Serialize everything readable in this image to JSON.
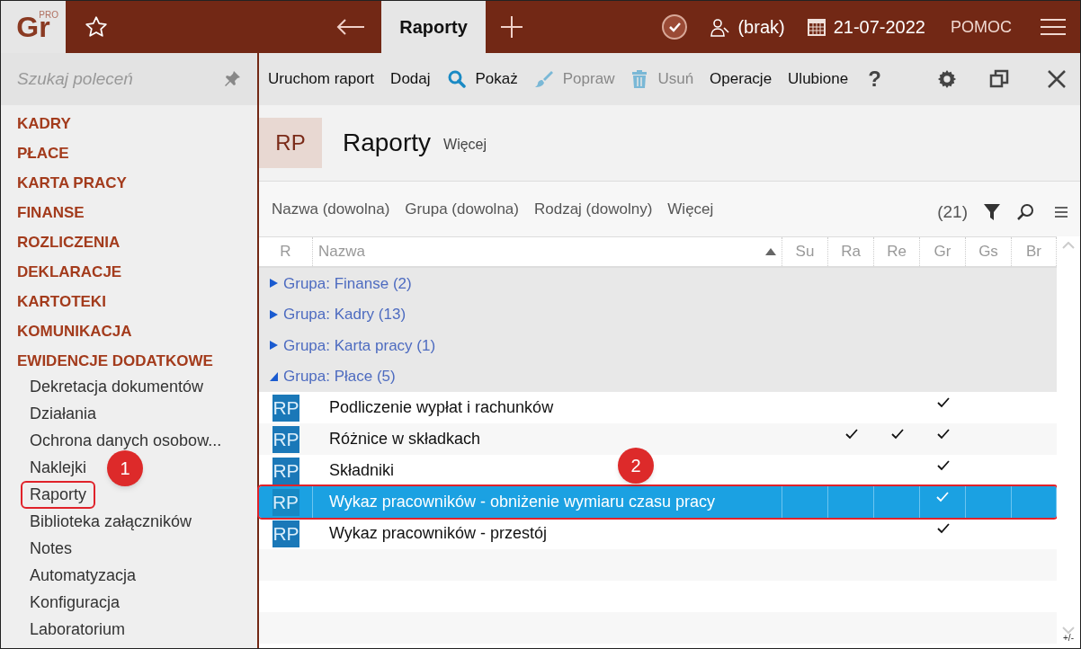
{
  "app": {
    "logo": "Gr",
    "logo_badge": "PRO"
  },
  "topbar": {
    "active_tab": "Raporty",
    "user": "(brak)",
    "date": "21-07-2022",
    "help": "POMOC"
  },
  "search": {
    "placeholder": "Szukaj poleceń"
  },
  "sidebar": {
    "items": [
      {
        "kind": "section",
        "label": "KADRY",
        "outlined": false
      },
      {
        "kind": "section",
        "label": "PŁACE",
        "outlined": false
      },
      {
        "kind": "section",
        "label": "KARTA PRACY",
        "outlined": false
      },
      {
        "kind": "section",
        "label": "FINANSE",
        "outlined": false
      },
      {
        "kind": "section",
        "label": "ROZLICZENIA",
        "outlined": false
      },
      {
        "kind": "section",
        "label": "DEKLARACJE",
        "outlined": false
      },
      {
        "kind": "section",
        "label": "KARTOTEKI",
        "outlined": false
      },
      {
        "kind": "section",
        "label": "KOMUNIKACJA",
        "outlined": false
      },
      {
        "kind": "section",
        "label": "EWIDENCJE DODATKOWE",
        "outlined": false
      },
      {
        "kind": "item",
        "label": "Dekretacja dokumentów",
        "outlined": false
      },
      {
        "kind": "item",
        "label": "Działania",
        "outlined": false
      },
      {
        "kind": "item",
        "label": "Ochrona danych osobow...",
        "outlined": false
      },
      {
        "kind": "item",
        "label": "Naklejki",
        "outlined": false
      },
      {
        "kind": "item",
        "label": "Raporty",
        "outlined": true
      },
      {
        "kind": "item",
        "label": "Biblioteka załączników",
        "outlined": false
      },
      {
        "kind": "item",
        "label": "Notes",
        "outlined": false
      },
      {
        "kind": "item",
        "label": "Automatyzacja",
        "outlined": false
      },
      {
        "kind": "item",
        "label": "Konfiguracja",
        "outlined": false
      },
      {
        "kind": "item",
        "label": "Laboratorium",
        "outlined": false
      }
    ]
  },
  "toolbar": [
    {
      "kind": "text",
      "label": "Uruchom raport",
      "disabled": false
    },
    {
      "kind": "text",
      "label": "Dodaj",
      "disabled": false
    },
    {
      "kind": "search",
      "label": "Pokaż",
      "disabled": false
    },
    {
      "kind": "brush",
      "label": "Popraw",
      "disabled": true
    },
    {
      "kind": "trash",
      "label": "Usuń",
      "disabled": true
    },
    {
      "kind": "text",
      "label": "Operacje",
      "disabled": false
    },
    {
      "kind": "text",
      "label": "Ulubione",
      "disabled": false
    },
    {
      "kind": "help",
      "label": "?",
      "disabled": false
    }
  ],
  "header": {
    "badge": "RP",
    "title": "Raporty",
    "more": "Więcej"
  },
  "filters": [
    "Nazwa (dowolna)",
    "Grupa (dowolna)",
    "Rodzaj (dowolny)",
    "Więcej"
  ],
  "count": "(21)",
  "table": {
    "columns": [
      "R",
      "Nazwa",
      "Su",
      "Ra",
      "Re",
      "Gr",
      "Gs",
      "Br"
    ],
    "groups": [
      {
        "label": "Grupa: Finanse (2)",
        "expanded": false
      },
      {
        "label": "Grupa: Kadry (13)",
        "expanded": false
      },
      {
        "label": "Grupa: Karta pracy (1)",
        "expanded": false
      },
      {
        "label": "Grupa: Płace (5)",
        "expanded": true,
        "rows": [
          {
            "icon": "RP",
            "name": "Podliczenie wypłat i rachunków",
            "selected": false,
            "outlined": false,
            "checks": {
              "gr": true
            }
          },
          {
            "icon": "RP",
            "name": "Różnice w składkach",
            "selected": false,
            "outlined": false,
            "checks": {
              "ra": true,
              "re": true,
              "gr": true
            }
          },
          {
            "icon": "RP",
            "name": "Składniki",
            "selected": false,
            "outlined": false,
            "checks": {
              "gr": true
            }
          },
          {
            "icon": "RP",
            "name": "Wykaz pracowników - obniżenie wymiaru czasu pracy",
            "selected": true,
            "outlined": true,
            "checks": {
              "gr": true
            }
          },
          {
            "icon": "RP",
            "name": "Wykaz pracowników - przestój",
            "selected": false,
            "outlined": false,
            "checks": {
              "gr": true
            }
          }
        ]
      }
    ]
  },
  "footer_mark": "+/-",
  "callouts": [
    {
      "label": "1"
    },
    {
      "label": "2"
    }
  ]
}
